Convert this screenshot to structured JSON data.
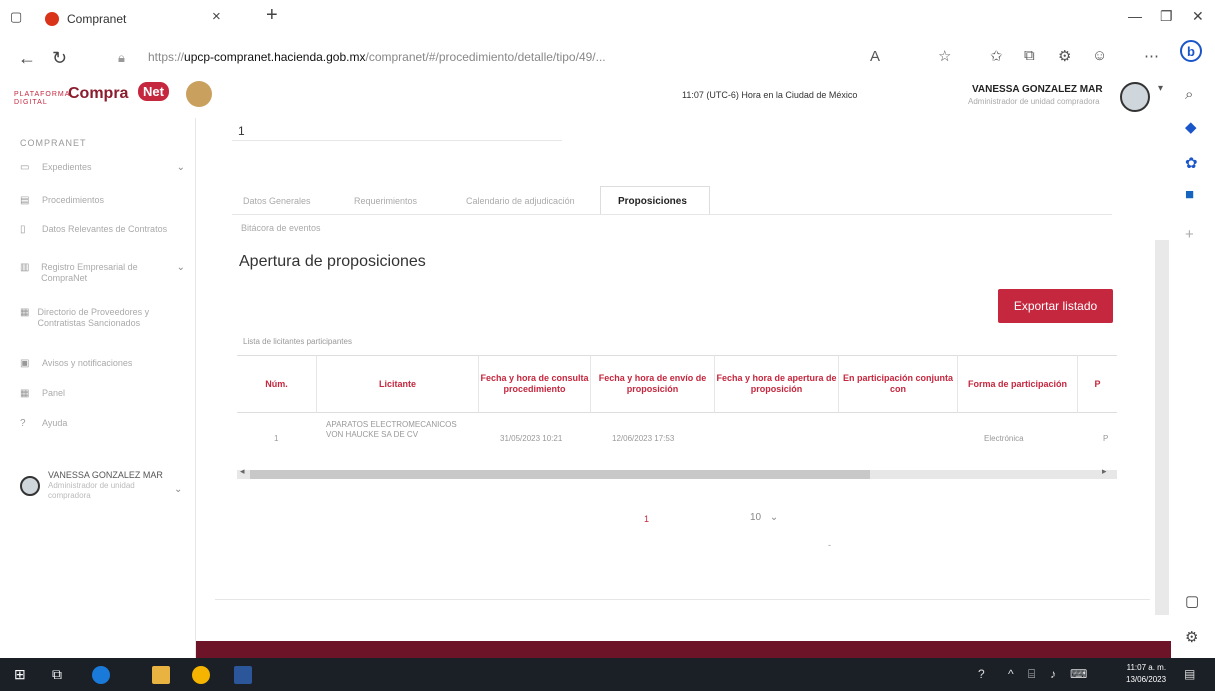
{
  "browser": {
    "tab_title": "Compranet",
    "tab_close": "×",
    "new_tab": "+",
    "url_prefix": "https://",
    "url_host": "upcp-compranet.hacienda.gob.mx",
    "url_path": "/compranet/#/procedimiento/detalle/tipo/49/..."
  },
  "header": {
    "logo_left": "PLATAFORMA DIGITAL",
    "logo_main": "Compra",
    "logo_net": "Net",
    "clock": "11:07 (UTC-6) Hora en la Ciudad de México",
    "user_name": "VANESSA GONZALEZ MAR",
    "user_role": "Administrador de unidad compradora"
  },
  "sidebar": {
    "title": "COMPRANET",
    "items": [
      {
        "label": "Expedientes"
      },
      {
        "label": "Procedimientos"
      },
      {
        "label": "Datos Relevantes de Contratos"
      },
      {
        "label": "Registro Empresarial de CompraNet"
      },
      {
        "label": "Directorio de Proveedores y Contratistas Sancionados"
      },
      {
        "label": "Avisos y notificaciones"
      },
      {
        "label": "Panel"
      },
      {
        "label": "Ayuda"
      }
    ],
    "user_name": "VANESSA GONZALEZ MAR",
    "user_role": "Administrador de unidad compradora"
  },
  "main": {
    "number": "1",
    "tabs": [
      "Datos Generales",
      "Requerimientos",
      "Calendario de adjudicación",
      "Proposiciones"
    ],
    "active_tab": "Proposiciones",
    "subtab": "Bitácora de eventos",
    "heading": "Apertura de proposiciones",
    "export_label": "Exportar listado",
    "list_label": "Lista de licitantes participantes",
    "columns": [
      "Núm.",
      "Licitante",
      "Fecha y hora de consulta procedimiento",
      "Fecha y hora de envío de proposición",
      "Fecha y hora de apertura de proposición",
      "En participación conjunta con",
      "Forma de participación",
      "P"
    ],
    "rows": [
      {
        "num": "1",
        "licitante": "APARATOS ELECTROMECANICOS VON HAUCKE SA DE CV",
        "consulta": "31/05/2023 10:21",
        "envio": "12/06/2023 17:53",
        "apertura": "",
        "conjunta": "",
        "forma": "Electrónica",
        "extra": "P"
      }
    ],
    "pagination_page": "1",
    "page_size": "10"
  },
  "taskbar": {
    "time": "11:07 a. m.",
    "date": "13/06/2023"
  },
  "colors": {
    "brand": "#c5273e",
    "footer": "#6d1428",
    "taskbar": "#1b2027"
  }
}
